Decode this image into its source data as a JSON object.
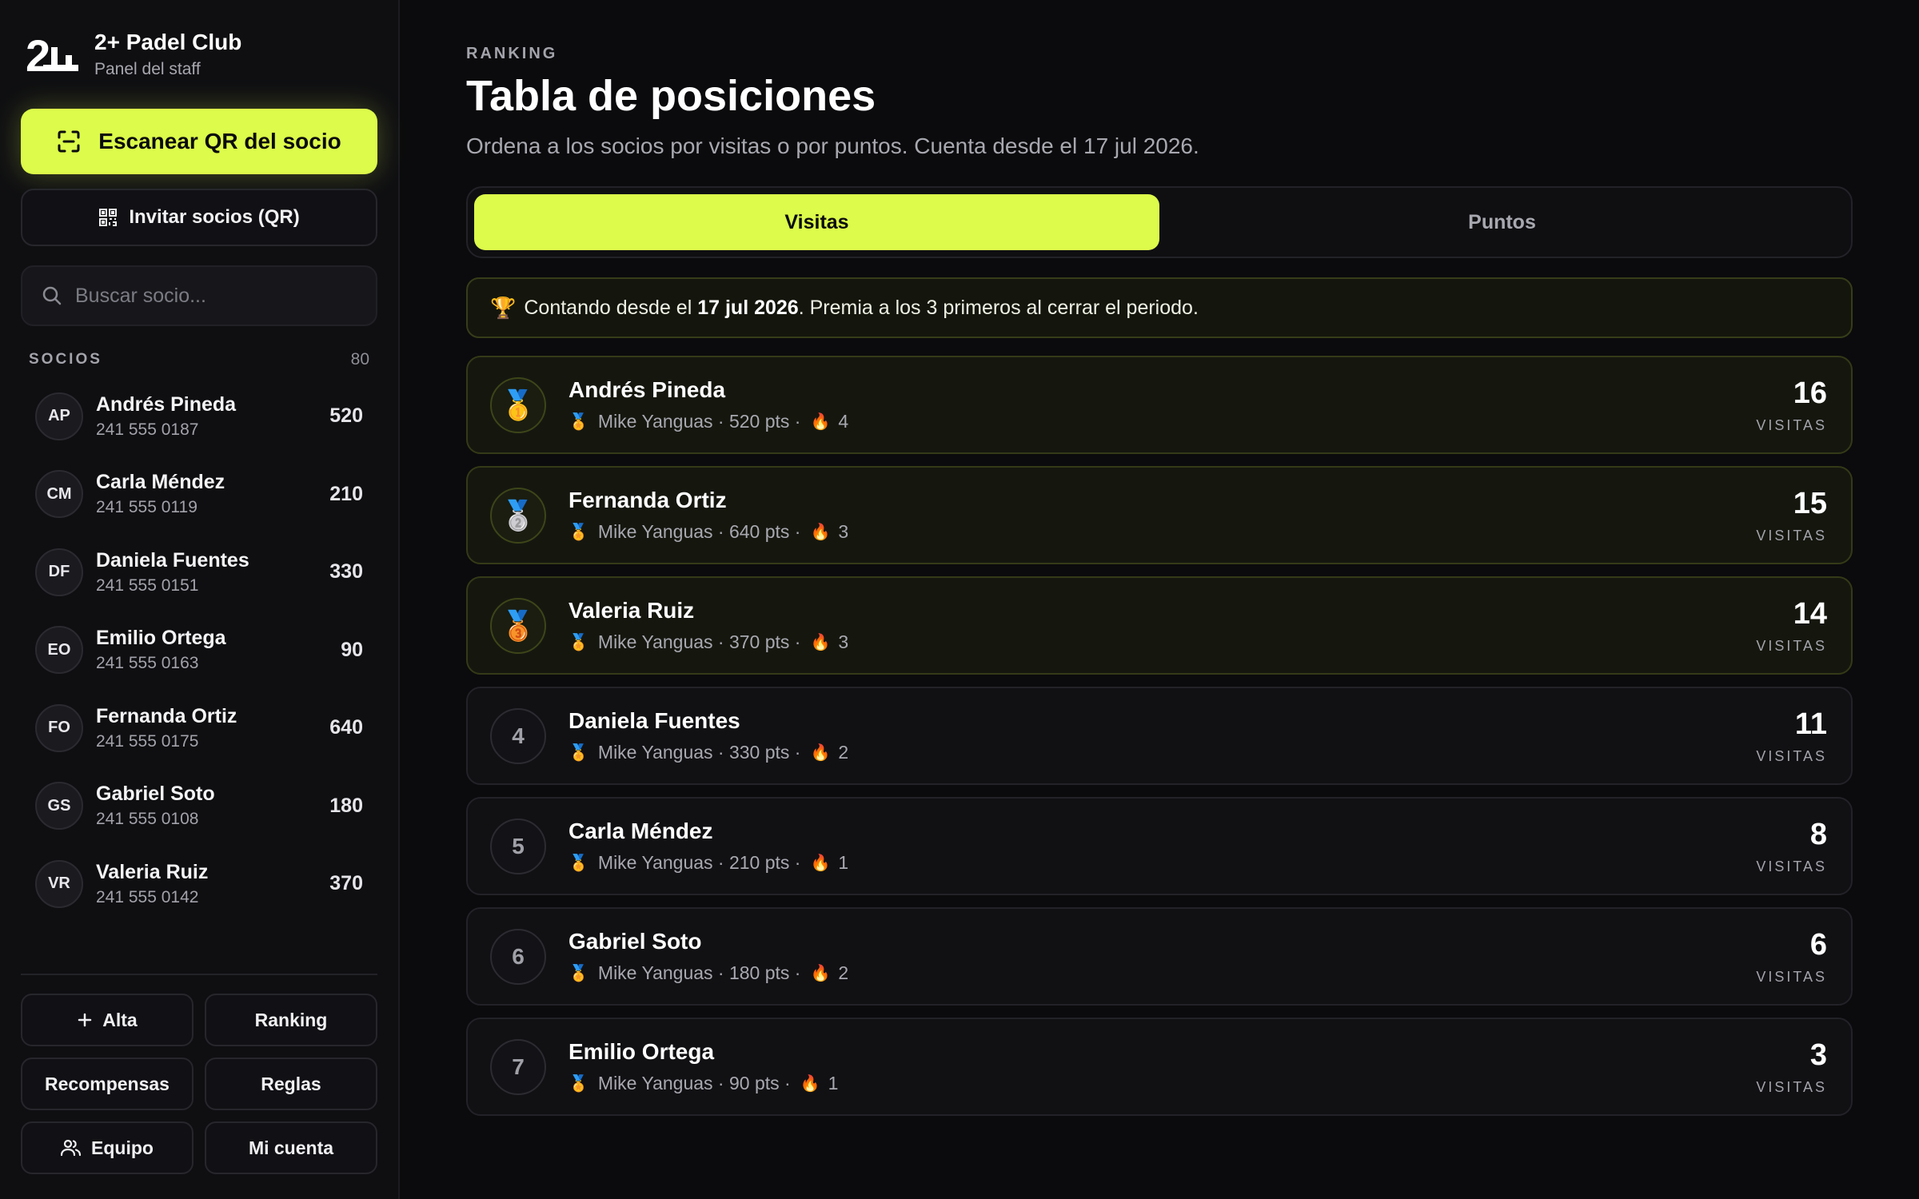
{
  "brand": {
    "logo_text": "2+",
    "title": "2+ Padel Club",
    "subtitle": "Panel del staff"
  },
  "sidebar": {
    "scan_label": "Escanear QR del socio",
    "invite_label": "Invitar socios (QR)",
    "search_placeholder": "Buscar socio...",
    "members_label": "SOCIOS",
    "members_count": "80",
    "members": [
      {
        "initials": "AP",
        "name": "Andrés Pineda",
        "phone": "241 555 0187",
        "points": "520"
      },
      {
        "initials": "CM",
        "name": "Carla Méndez",
        "phone": "241 555 0119",
        "points": "210"
      },
      {
        "initials": "DF",
        "name": "Daniela Fuentes",
        "phone": "241 555 0151",
        "points": "330"
      },
      {
        "initials": "EO",
        "name": "Emilio Ortega",
        "phone": "241 555 0163",
        "points": "90"
      },
      {
        "initials": "FO",
        "name": "Fernanda Ortiz",
        "phone": "241 555 0175",
        "points": "640"
      },
      {
        "initials": "GS",
        "name": "Gabriel Soto",
        "phone": "241 555 0108",
        "points": "180"
      },
      {
        "initials": "VR",
        "name": "Valeria Ruiz",
        "phone": "241 555 0142",
        "points": "370"
      }
    ],
    "actions": {
      "alta": "Alta",
      "ranking": "Ranking",
      "recompensas": "Recompensas",
      "reglas": "Reglas",
      "equipo": "Equipo",
      "mi_cuenta": "Mi cuenta"
    }
  },
  "main": {
    "eyebrow": "RANKING",
    "title": "Tabla de posiciones",
    "subtitle": "Ordena a los socios por visitas o por puntos. Cuenta desde el 17 jul 2026.",
    "tabs": [
      {
        "label": "Visitas",
        "active": true
      },
      {
        "label": "Puntos",
        "active": false
      }
    ],
    "banner": {
      "icon": "🏆",
      "prefix": "Contando desde el ",
      "date": "17 jul 2026",
      "suffix": ". Premia a los 3 primeros al cerrar el periodo."
    },
    "ranking": [
      {
        "position": "1",
        "medal": "🥇",
        "name": "Andrés Pineda",
        "level_icon": "🏅",
        "meta": "Mike Yanguas · 520 pts ·",
        "streak_icon": "🔥",
        "streak": "4",
        "visits": "16",
        "unit": "VISITAS"
      },
      {
        "position": "2",
        "medal": "🥈",
        "name": "Fernanda Ortiz",
        "level_icon": "🏅",
        "meta": "Mike Yanguas · 640 pts ·",
        "streak_icon": "🔥",
        "streak": "3",
        "visits": "15",
        "unit": "VISITAS"
      },
      {
        "position": "3",
        "medal": "🥉",
        "name": "Valeria Ruiz",
        "level_icon": "🏅",
        "meta": "Mike Yanguas · 370 pts ·",
        "streak_icon": "🔥",
        "streak": "3",
        "visits": "14",
        "unit": "VISITAS"
      },
      {
        "position": "4",
        "medal": "",
        "name": "Daniela Fuentes",
        "level_icon": "🏅",
        "meta": "Mike Yanguas · 330 pts ·",
        "streak_icon": "🔥",
        "streak": "2",
        "visits": "11",
        "unit": "VISITAS"
      },
      {
        "position": "5",
        "medal": "",
        "name": "Carla Méndez",
        "level_icon": "🏅",
        "meta": "Mike Yanguas · 210 pts ·",
        "streak_icon": "🔥",
        "streak": "1",
        "visits": "8",
        "unit": "VISITAS"
      },
      {
        "position": "6",
        "medal": "",
        "name": "Gabriel Soto",
        "level_icon": "🏅",
        "meta": "Mike Yanguas · 180 pts ·",
        "streak_icon": "🔥",
        "streak": "2",
        "visits": "6",
        "unit": "VISITAS"
      },
      {
        "position": "7",
        "medal": "",
        "name": "Emilio Ortega",
        "level_icon": "🏅",
        "meta": "Mike Yanguas · 90 pts ·",
        "streak_icon": "🔥",
        "streak": "1",
        "visits": "3",
        "unit": "VISITAS"
      }
    ]
  },
  "colors": {
    "accent": "#dcfb4a",
    "background": "#0b0b0d",
    "sidebar": "#0f0f12",
    "card": "#111114",
    "top_card": "#15170f"
  }
}
